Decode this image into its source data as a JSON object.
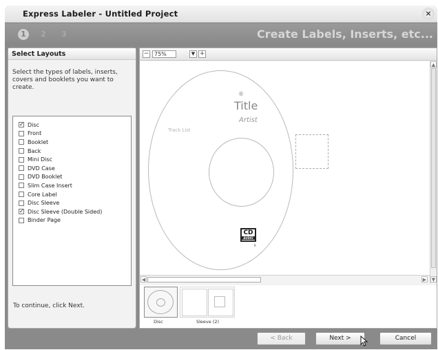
{
  "window": {
    "title": "Express Labeler - Untitled Project",
    "close_glyph": "×"
  },
  "steps": {
    "items": [
      "1",
      "2",
      "3"
    ],
    "heading": "Create Labels, Inserts, etc..."
  },
  "layouts_panel": {
    "header": "Select Layouts",
    "description": "Select the types of labels, inserts, covers and booklets you want to create.",
    "items": [
      {
        "label": "Disc",
        "checked": true
      },
      {
        "label": "Front",
        "checked": false
      },
      {
        "label": "Booklet",
        "checked": false
      },
      {
        "label": "Back",
        "checked": false
      },
      {
        "label": "Mini Disc",
        "checked": false
      },
      {
        "label": "DVD Case",
        "checked": false
      },
      {
        "label": "DVD Booklet",
        "checked": false
      },
      {
        "label": "Slim Case Insert",
        "checked": false
      },
      {
        "label": "Core Label",
        "checked": false
      },
      {
        "label": "Disc Sleeve",
        "checked": false
      },
      {
        "label": "Disc Sleeve (Double Sided)",
        "checked": true
      },
      {
        "label": "Binder Page",
        "checked": false
      }
    ],
    "continue_text": "To continue, click Next."
  },
  "toolbar": {
    "zoom_out": "−",
    "zoom_value": "75%",
    "zoom_dropdown": "▼",
    "zoom_in": "+"
  },
  "preview": {
    "copyright_mark": "®",
    "title_text": "Title",
    "artist_text": "Artist",
    "track_list_text": "Track List",
    "cd_logo_top": "CD",
    "cd_logo_bottom": "AUDIO",
    "cd_logo_mark": "R"
  },
  "thumbnails": [
    {
      "label": "Disc",
      "selected": true
    },
    {
      "label": "Sleeve (2)",
      "selected": false
    }
  ],
  "buttons": {
    "back": "< Back",
    "next": "Next >",
    "cancel": "Cancel"
  },
  "colors": {
    "chrome": "#8a8a8a",
    "panel": "#f2f2f2",
    "heading": "#d6d6d6"
  }
}
